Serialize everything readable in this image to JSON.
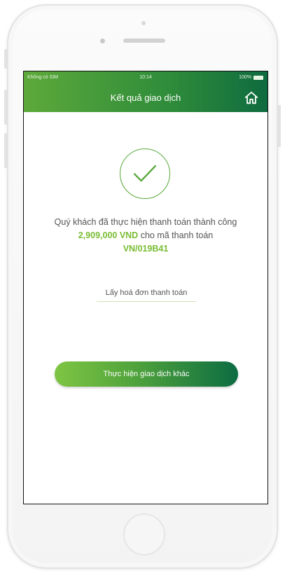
{
  "status_bar": {
    "carrier": "Không có SIM",
    "time": "10:14",
    "battery": "100%"
  },
  "header": {
    "title": "Kết quả giao dịch",
    "home_icon": "home-icon"
  },
  "result": {
    "icon": "checkmark-icon",
    "message_part1": "Quý khách đã thực hiện thanh toán thành công ",
    "amount": "2,909,000 VND",
    "message_part2": " cho mã thanh toán ",
    "payment_code": "VN/019B41"
  },
  "invoice_link": "Lấy hoá đơn thanh toán",
  "cta_label": "Thực hiện giao dịch khác",
  "colors": {
    "brand_green": "#2e8c3a",
    "highlight": "#7abd33",
    "dark_green": "#0c6c42"
  }
}
